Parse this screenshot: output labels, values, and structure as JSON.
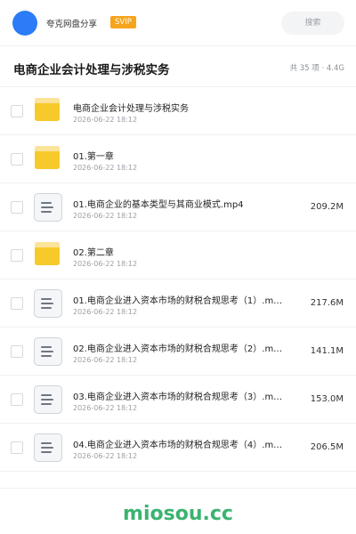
{
  "header": {
    "owner_name": "夸克网盘分享",
    "badge": "SVIP",
    "search_placeholder": "搜索",
    "accent_color": "#2b7cf6",
    "badge_color": "#f7a41d"
  },
  "folder": {
    "title": "电商企业会计处理与涉税实务",
    "summary": "共 35 项 · 4.4G"
  },
  "files": [
    {
      "type": "folder",
      "icon": "folder-icon",
      "name": "电商企业会计处理与涉税实务",
      "date": "2026-06-22 18:12",
      "size": ""
    },
    {
      "type": "folder",
      "icon": "folder-icon",
      "name": "01.第一章",
      "date": "2026-06-22 18:12",
      "size": ""
    },
    {
      "type": "file",
      "icon": "document-icon",
      "name": "01.电商企业的基本类型与其商业模式.mp4",
      "date": "2026-06-22 18:12",
      "size": "209.2M"
    },
    {
      "type": "folder",
      "icon": "folder-icon",
      "name": "02.第二章",
      "date": "2026-06-22 18:12",
      "size": ""
    },
    {
      "type": "file",
      "icon": "document-icon",
      "name": "01.电商企业进入资本市场的财税合规思考（1）.m…",
      "date": "2026-06-22 18:12",
      "size": "217.6M"
    },
    {
      "type": "file",
      "icon": "document-icon",
      "name": "02.电商企业进入资本市场的财税合规思考（2）.m…",
      "date": "2026-06-22 18:12",
      "size": "141.1M"
    },
    {
      "type": "file",
      "icon": "document-icon",
      "name": "03.电商企业进入资本市场的财税合规思考（3）.m…",
      "date": "2026-06-22 18:12",
      "size": "153.0M"
    },
    {
      "type": "file",
      "icon": "document-icon",
      "name": "04.电商企业进入资本市场的财税合规思考（4）.m…",
      "date": "2026-06-22 18:12",
      "size": "206.5M"
    }
  ],
  "footer": {
    "watermark": "miosou.cc",
    "watermark_color": "#3cb371"
  }
}
